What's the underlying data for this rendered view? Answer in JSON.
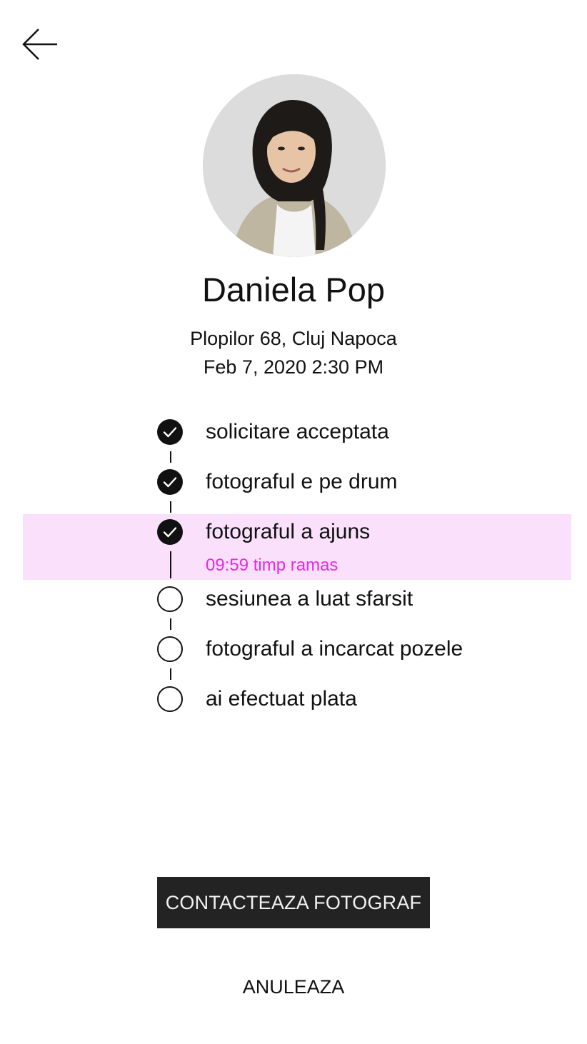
{
  "header": {
    "back_icon": "arrow-left-icon"
  },
  "profile": {
    "name": "Daniela Pop",
    "address": "Plopilor 68, Cluj Napoca",
    "datetime": "Feb 7, 2020 2:30 PM",
    "avatar": "photographer-avatar"
  },
  "timeline": {
    "steps": [
      {
        "label": "solicitare acceptata",
        "status": "done"
      },
      {
        "label": "fotograful e pe drum",
        "status": "done"
      },
      {
        "label": "fotograful a ajuns",
        "status": "done",
        "highlight": true
      },
      {
        "label": "sesiunea a luat sfarsit",
        "status": "pending"
      },
      {
        "label": "fotograful a incarcat pozele",
        "status": "pending"
      },
      {
        "label": "ai efectuat plata",
        "status": "pending"
      }
    ],
    "timer_text": "09:59 timp ramas",
    "done_icon": "check-circle-icon",
    "pending_icon": "empty-circle-icon"
  },
  "actions": {
    "contact_label": "CONTACTEAZA FOTOGRAF",
    "cancel_label": "ANULEAZA"
  },
  "colors": {
    "highlight_bg": "#fbe0fb",
    "timer_text": "#e629e6",
    "primary_button_bg": "#232323",
    "text": "#111111"
  }
}
